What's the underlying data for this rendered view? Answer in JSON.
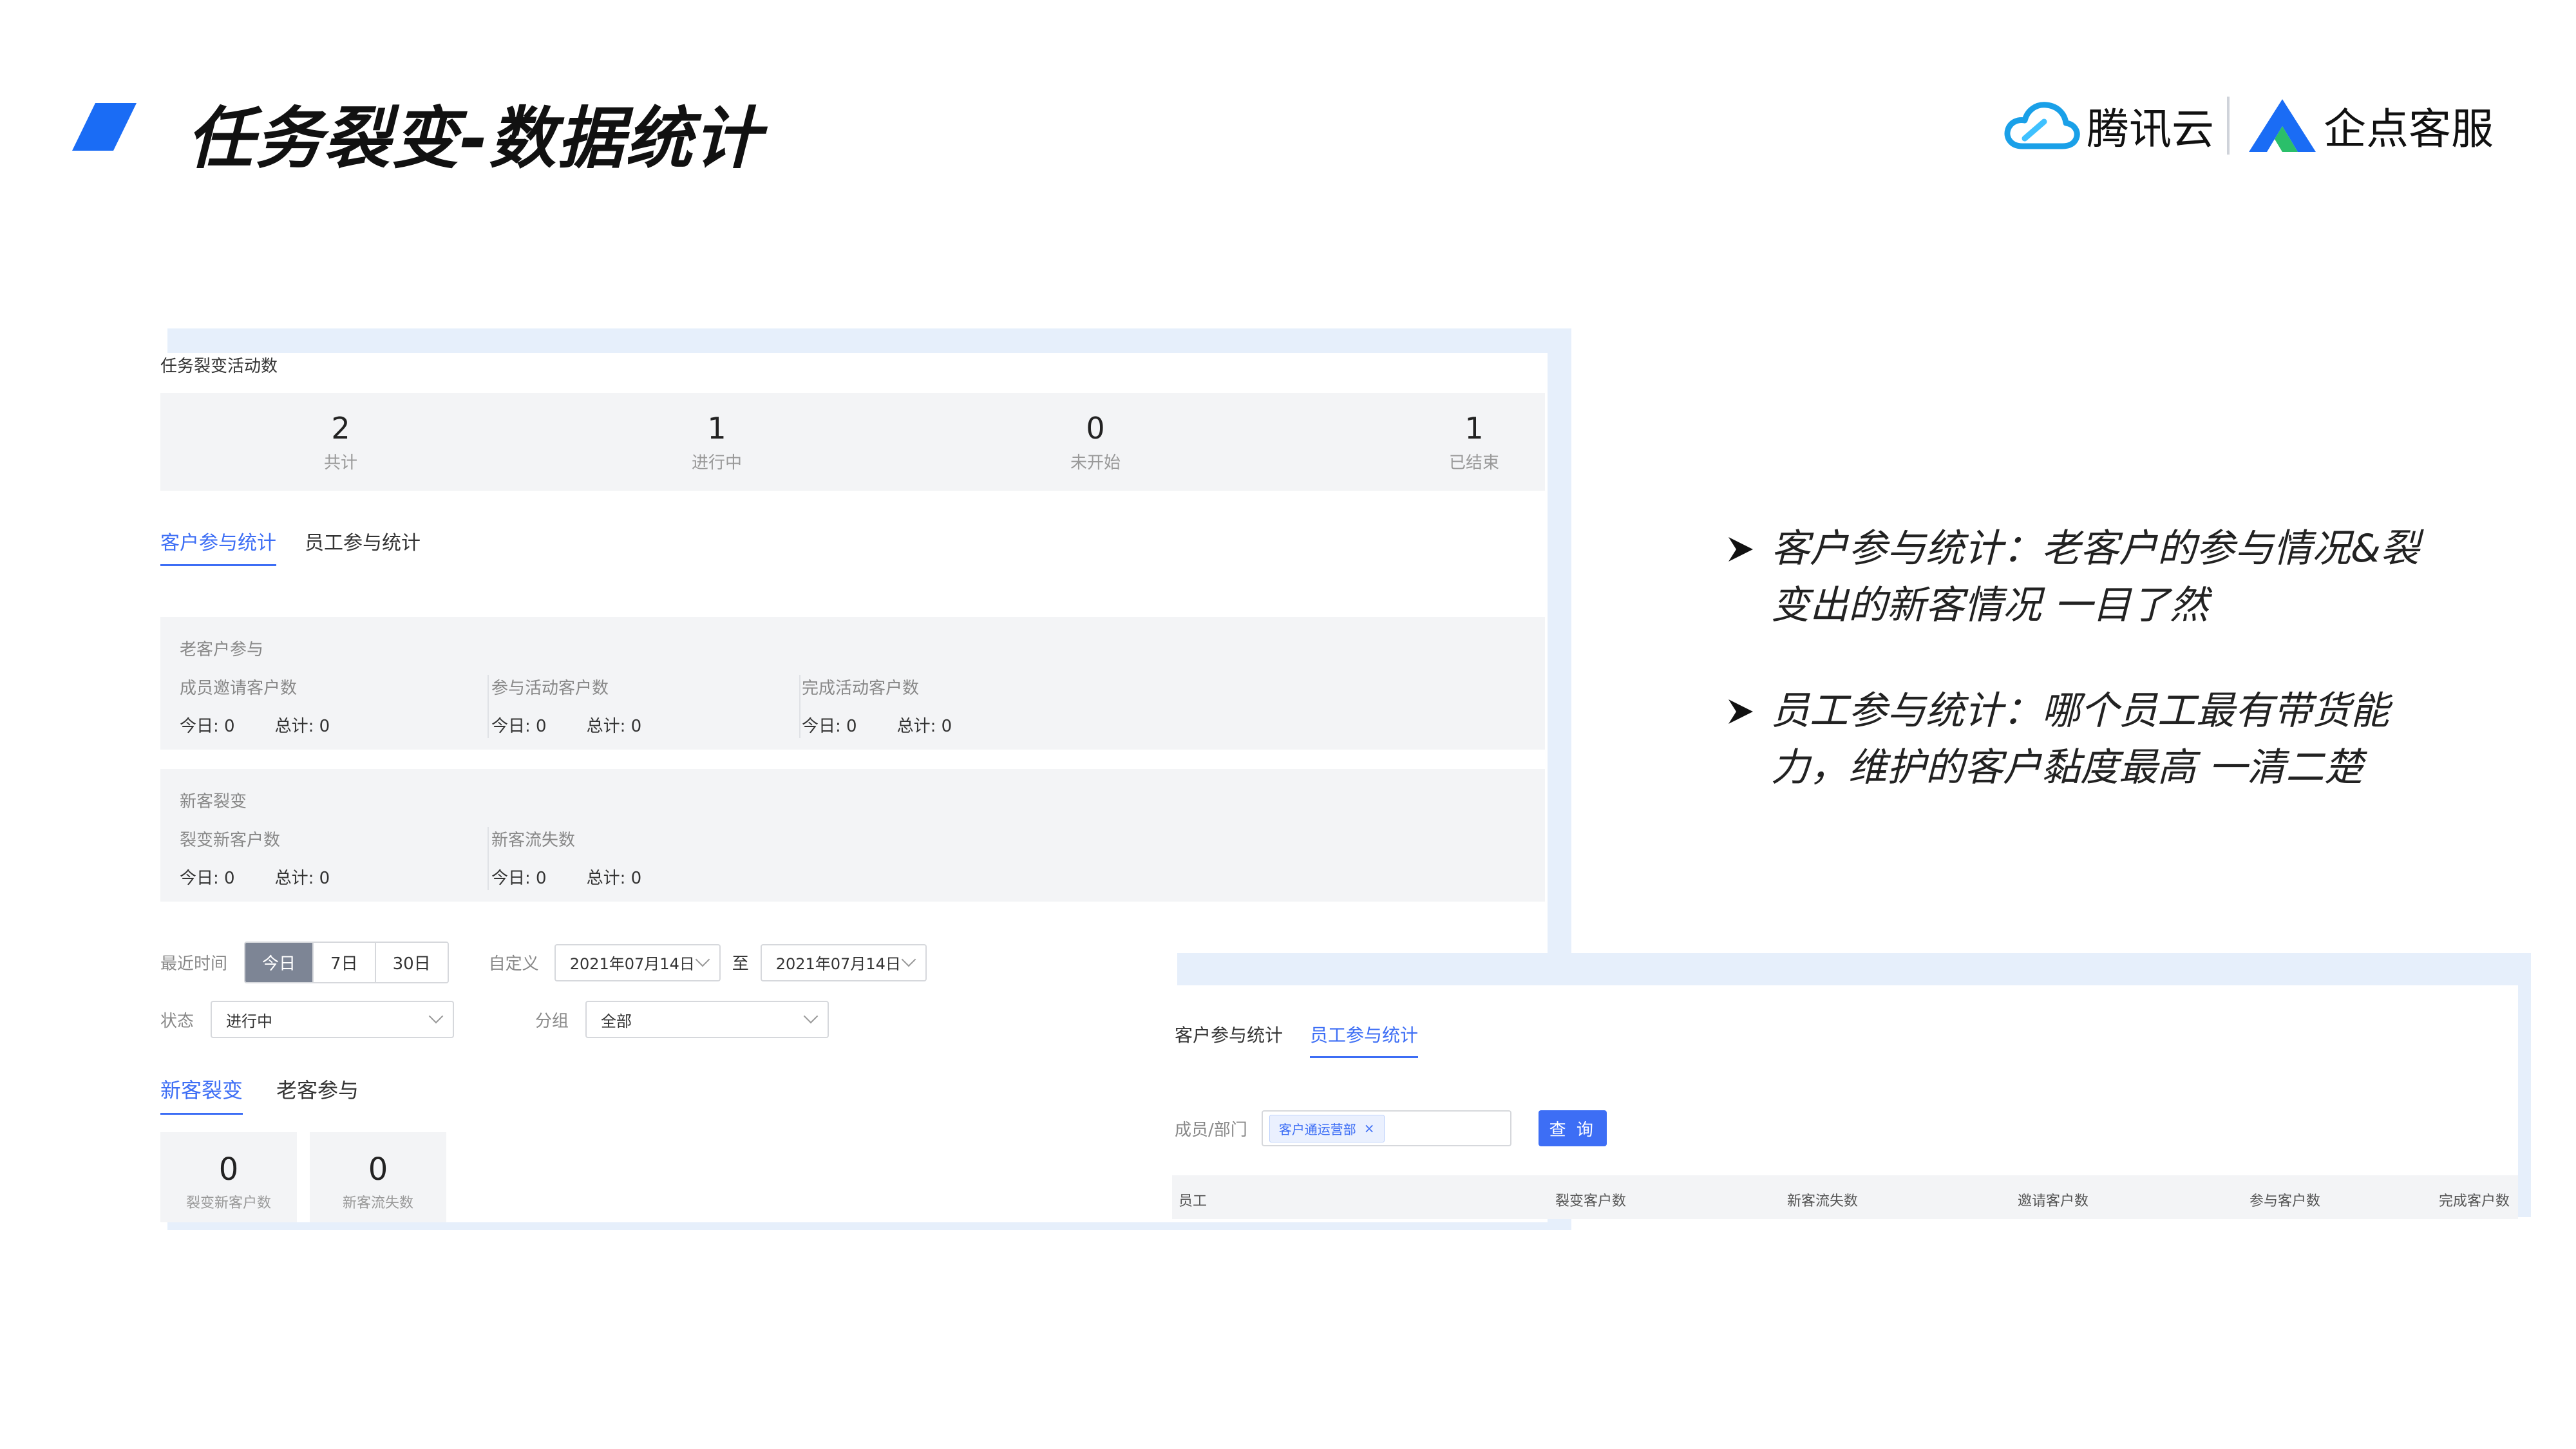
{
  "header": {
    "title": "任务裂变-数据统计",
    "brand_tencent": "腾讯云",
    "brand_qidian": "企点客服",
    "accent_color": "#1a6cf5"
  },
  "shot1": {
    "caption": "任务裂变活动数",
    "stats": [
      {
        "value": "2",
        "label": "共计"
      },
      {
        "value": "1",
        "label": "进行中"
      },
      {
        "value": "0",
        "label": "未开始"
      },
      {
        "value": "1",
        "label": "已结束"
      }
    ],
    "tabs": [
      "客户参与统计",
      "员工参与统计"
    ],
    "old_customer": {
      "title": "老客户参与",
      "metrics": [
        {
          "title": "成员邀请客户数",
          "today": "今日: 0",
          "total": "总计: 0"
        },
        {
          "title": "参与活动客户数",
          "today": "今日: 0",
          "total": "总计: 0"
        },
        {
          "title": "完成活动客户数",
          "today": "今日: 0",
          "total": "总计: 0"
        }
      ]
    },
    "new_customer": {
      "title": "新客裂变",
      "metrics": [
        {
          "title": "裂变新客户数",
          "today": "今日: 0",
          "total": "总计: 0"
        },
        {
          "title": "新客流失数",
          "today": "今日: 0",
          "total": "总计: 0"
        }
      ]
    },
    "filters": {
      "recent_label": "最近时间",
      "ranges": [
        "今日",
        "7日",
        "30日"
      ],
      "custom_label": "自定义",
      "date_start": "2021年07月14日",
      "to_label": "至",
      "date_end": "2021年07月14日",
      "status_label": "状态",
      "status_value": "进行中",
      "group_label": "分组",
      "group_value": "全部"
    },
    "bottom_tabs": [
      "新客裂变",
      "老客参与"
    ],
    "cards": [
      {
        "value": "0",
        "label": "裂变新客户数"
      },
      {
        "value": "0",
        "label": "新客流失数"
      }
    ]
  },
  "shot2": {
    "tabs": [
      "客户参与统计",
      "员工参与统计"
    ],
    "member_label": "成员/部门",
    "chip": "客户通运营部",
    "chip_close": "×",
    "query_button": "查 询",
    "columns": [
      "员工",
      "裂变客户数",
      "新客流失数",
      "邀请客户数",
      "参与客户数",
      "完成客户数"
    ]
  },
  "bullets": [
    "客户参与统计：老客户的参与情况&裂变出的新客情况 一目了然",
    "员工参与统计：哪个员工最有带货能力，维护的客户黏度最高 一清二楚"
  ]
}
